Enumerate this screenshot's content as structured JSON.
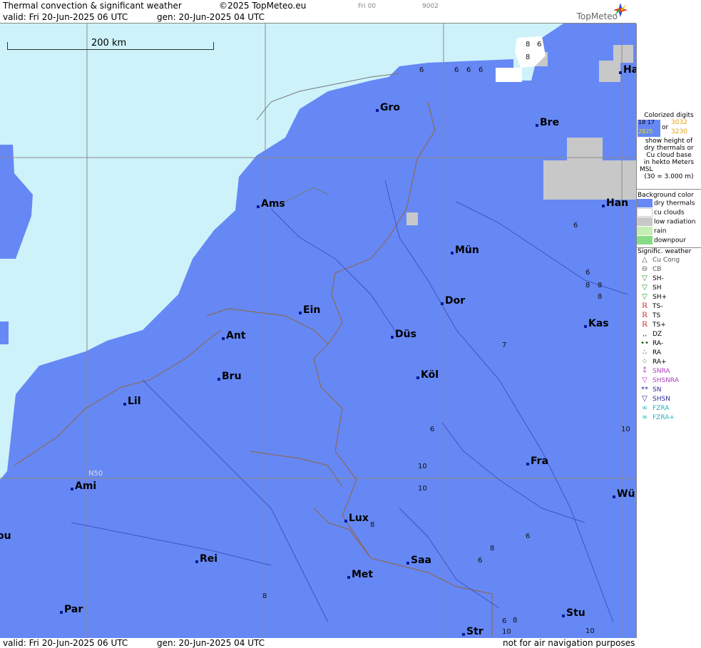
{
  "header": {
    "title": "Thermal convection & significant weather",
    "copyright": "©2025 TopMeteo.eu",
    "time_code": "Fri 00",
    "code": "9002",
    "valid": "valid:  Fri  20-Jun-2025  06 UTC",
    "gen": "gen: 20-Jun-2025 04 UTC",
    "logo": "TopMeteo"
  },
  "map": {
    "scale_label": "200 km",
    "lat_label": "N50",
    "cities": [
      "Ha",
      "Gro",
      "Bre",
      "Ams",
      "Han",
      "Mün",
      "Dor",
      "Ein",
      "Kas",
      "Ant",
      "Düs",
      "Köl",
      "Bru",
      "Lil",
      "Fra",
      "Ami",
      "Wü",
      "Lux",
      "ou",
      "Rei",
      "Saa",
      "Met",
      "Par",
      "Stu",
      "Str"
    ],
    "digits": [
      "6",
      "8",
      "8",
      "6",
      "6",
      "6",
      "6",
      "6",
      "6",
      "8",
      "8",
      "8",
      "7",
      "10",
      "6",
      "10",
      "8",
      "6",
      "8",
      "6",
      "8",
      "6",
      "8",
      "10",
      "10",
      "10"
    ]
  },
  "colors": {
    "sea": "#cdf2fa",
    "dry_thermals": "#6688f5",
    "cu_clouds": "#ffffff",
    "low_radiation": "#c8c8c8",
    "rain": "#c4eeb4",
    "downpour": "#86dc86"
  },
  "legend": {
    "colorized_title": "Colorized digits",
    "sample_a": "18 17",
    "sample_b": "3032",
    "sample_c": "2825",
    "sample_d": "3230",
    "or": "or",
    "desc1": "show height of",
    "desc2": "dry thermals or",
    "desc3": "Cu cloud base",
    "desc4": "in hekto Meters",
    "desc5": "MSL",
    "desc6": "(30 = 3.000 m)",
    "bg_title": "Background color",
    "bg_items": [
      "dry thermals",
      "cu clouds",
      "low radiation",
      "rain",
      "downpour"
    ],
    "sig_title": "Signific. weather",
    "sig_items": [
      "Cu Cong",
      "CB",
      "SH-",
      "SH",
      "SH+",
      "TS-",
      "TS",
      "TS+",
      "DZ",
      "RA-",
      "RA",
      "RA+",
      "SNRA",
      "SHSNRA",
      "SN",
      "SHSN",
      "FZRA",
      "FZRA+"
    ]
  },
  "footer": {
    "valid": "valid:  Fri  20-Jun-2025  06 UTC",
    "gen": "gen: 20-Jun-2025 04 UTC",
    "disclaimer": "not for air navigation purposes"
  }
}
